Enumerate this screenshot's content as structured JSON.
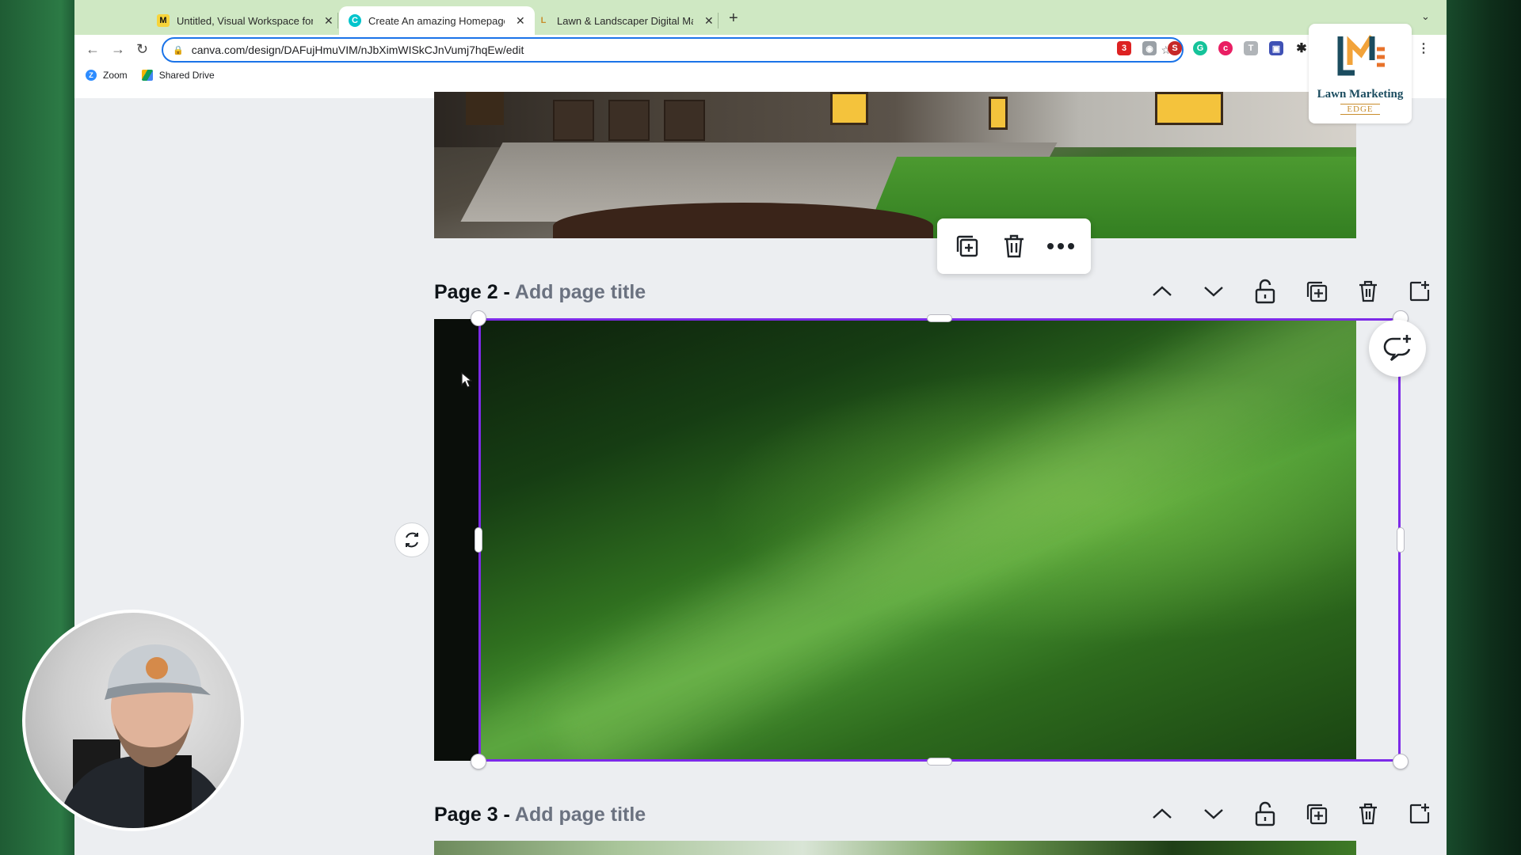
{
  "browser": {
    "tabs": [
      {
        "title": "Untitled, Visual Workspace for",
        "active": false,
        "favicon": "miro-icon"
      },
      {
        "title": "Create An amazing Homepage",
        "active": true,
        "favicon": "canva-icon"
      },
      {
        "title": "Lawn & Landscaper Digital Mar",
        "active": false,
        "favicon": "lawn-marketing-icon"
      }
    ],
    "new_tab": "+",
    "url": "canva.com/design/DAFujHmuVIM/nJbXimWISkCJnVumj7hqEw/edit",
    "bookmarks": [
      {
        "label": "Zoom",
        "icon": "zoom-icon"
      },
      {
        "label": "Shared Drive",
        "icon": "google-drive-icon"
      }
    ],
    "extension_badge": "3"
  },
  "logo": {
    "title": "Lawn Marketing",
    "subtitle": "EDGE"
  },
  "editor": {
    "page2": {
      "number_label": "Page 2 -",
      "title_placeholder": "Add page title"
    },
    "page3": {
      "number_label": "Page 3 -",
      "title_placeholder": "Add page title"
    }
  },
  "colors": {
    "selection": "#7d2ae8",
    "active_url_border": "#1a73e8",
    "tabstrip": "#cfe8c3"
  }
}
